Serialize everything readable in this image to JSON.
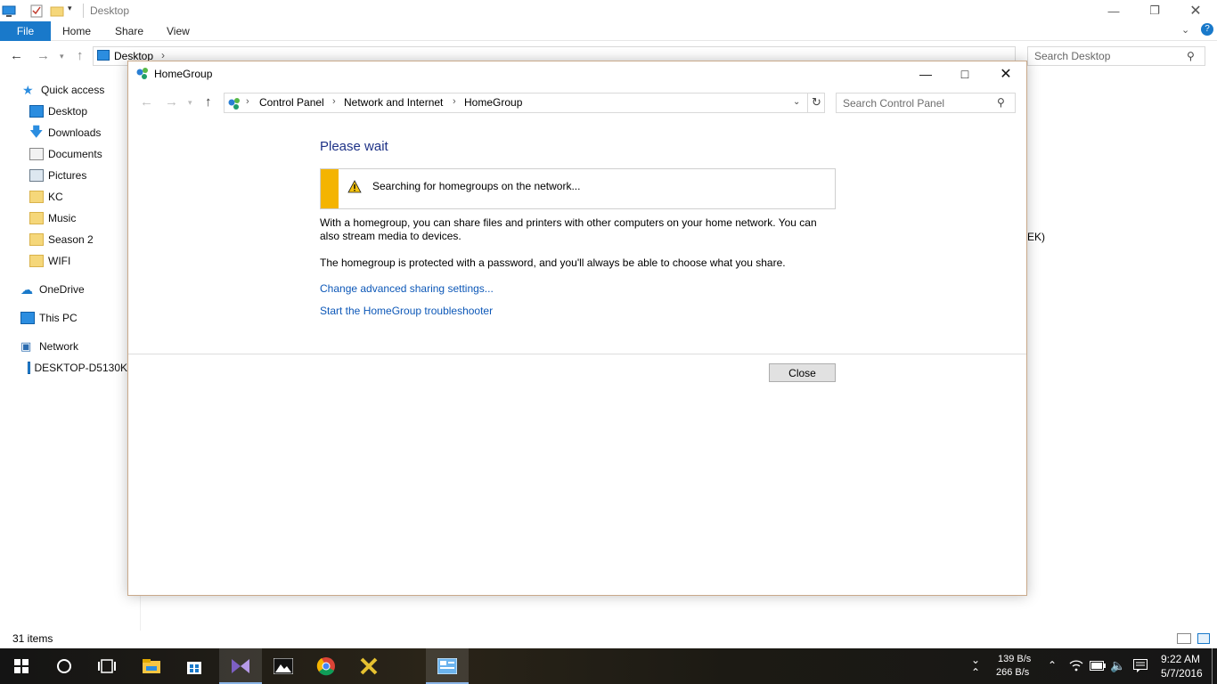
{
  "explorer": {
    "title": "Desktop",
    "ribbon_tabs": {
      "file": "File",
      "home": "Home",
      "share": "Share",
      "view": "View"
    },
    "address_location": "Desktop",
    "search_placeholder": "Search Desktop",
    "nav": {
      "quick_access": "Quick access",
      "desktop": "Desktop",
      "downloads": "Downloads",
      "documents": "Documents",
      "pictures": "Pictures",
      "kc": "KC",
      "music": "Music",
      "season2": "Season 2",
      "wifi": "WIFI",
      "onedrive": "OneDrive",
      "this_pc": "This PC",
      "network": "Network",
      "desktop_pc": "DESKTOP-D5130K"
    },
    "partial_file_text": "EK)",
    "status": "31 items"
  },
  "dialog": {
    "title": "HomeGroup",
    "breadcrumb": [
      "Control Panel",
      "Network and Internet",
      "HomeGroup"
    ],
    "search_placeholder": "Search Control Panel",
    "heading": "Please wait",
    "info_message": "Searching for homegroups on the network...",
    "paragraph1": "With a homegroup, you can share files and printers with other computers on your home network. You can also stream media to devices.",
    "paragraph2": "The homegroup is protected with a password, and you'll always be able to choose what you share.",
    "link_sharing": "Change advanced sharing settings...",
    "link_troubleshooter": "Start the HomeGroup troubleshooter",
    "close_label": "Close"
  },
  "taskbar": {
    "net_up": "139 B/s",
    "net_down": "266 B/s",
    "time": "9:22 AM",
    "date": "5/7/2016"
  },
  "colors": {
    "accent": "#1979ca",
    "heading_blue": "#1e3287",
    "link_blue": "#0d58b8",
    "warning_yellow": "#f4b400"
  }
}
